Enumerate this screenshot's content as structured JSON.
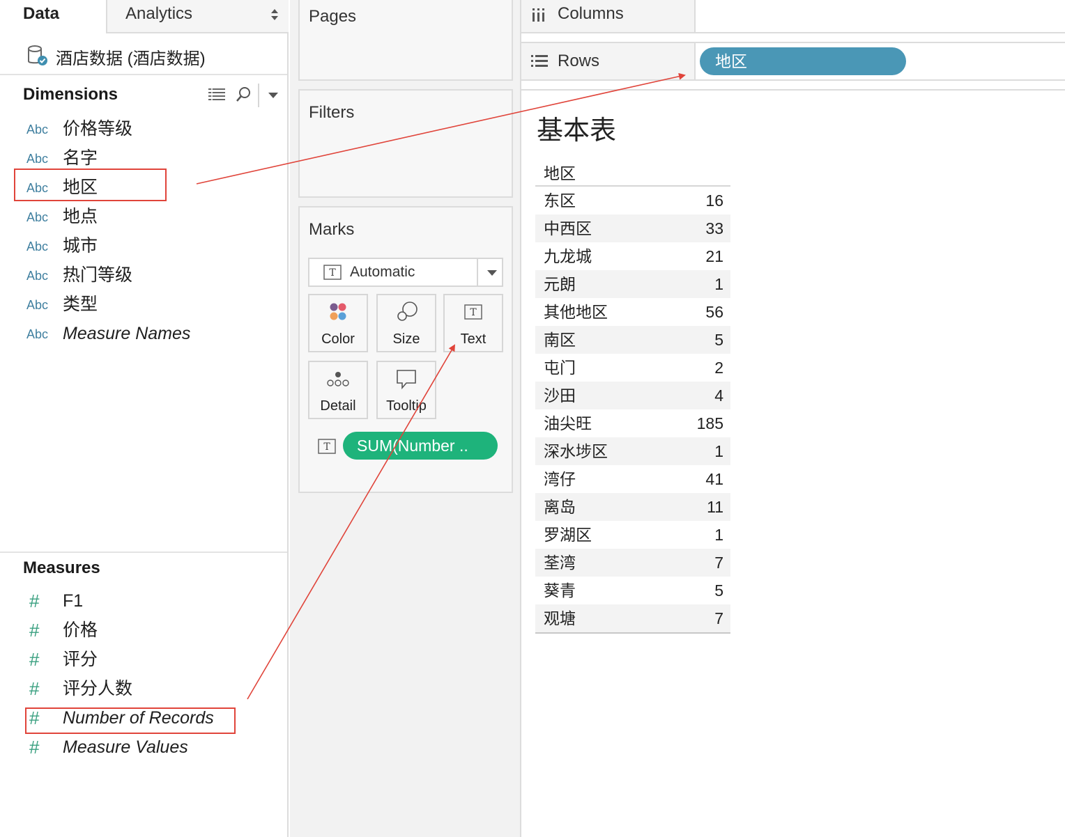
{
  "tabs": {
    "data": "Data",
    "analytics": "Analytics"
  },
  "datasource": {
    "name": "酒店数据 (酒店数据)"
  },
  "dimensions": {
    "title": "Dimensions",
    "type_label": "Abc",
    "items": [
      {
        "label": "价格等级",
        "italic": false
      },
      {
        "label": "名字",
        "italic": false
      },
      {
        "label": "地区",
        "italic": false,
        "highlighted": true
      },
      {
        "label": "地点",
        "italic": false
      },
      {
        "label": "城市",
        "italic": false
      },
      {
        "label": "热门等级",
        "italic": false
      },
      {
        "label": "类型",
        "italic": false
      },
      {
        "label": "Measure Names",
        "italic": true
      }
    ]
  },
  "measures": {
    "title": "Measures",
    "items": [
      {
        "label": "F1",
        "italic": false
      },
      {
        "label": "价格",
        "italic": false
      },
      {
        "label": "评分",
        "italic": false
      },
      {
        "label": "评分人数",
        "italic": false
      },
      {
        "label": "Number of Records",
        "italic": true,
        "highlighted": true
      },
      {
        "label": "Measure Values",
        "italic": true
      }
    ]
  },
  "cards": {
    "pages": "Pages",
    "filters": "Filters",
    "marks": "Marks"
  },
  "marks": {
    "type": "Automatic",
    "buttons": {
      "color": "Color",
      "size": "Size",
      "text": "Text",
      "detail": "Detail",
      "tooltip": "Tooltip"
    },
    "text_pill": "SUM(Number .."
  },
  "shelves": {
    "columns": "Columns",
    "rows": "Rows",
    "rows_pill": "地区"
  },
  "view": {
    "title": "基本表",
    "header": "地区",
    "rows": [
      {
        "name": "东区",
        "value": "16"
      },
      {
        "name": "中西区",
        "value": "33"
      },
      {
        "name": "九龙城",
        "value": "21"
      },
      {
        "name": "元朗",
        "value": "1"
      },
      {
        "name": "其他地区",
        "value": "56"
      },
      {
        "name": "南区",
        "value": "5"
      },
      {
        "name": "屯门",
        "value": "2"
      },
      {
        "name": "沙田",
        "value": "4"
      },
      {
        "name": "油尖旺",
        "value": "185"
      },
      {
        "name": "深水埗区",
        "value": "1"
      },
      {
        "name": "湾仔",
        "value": "41"
      },
      {
        "name": "离岛",
        "value": "11"
      },
      {
        "name": "罗湖区",
        "value": "1"
      },
      {
        "name": "荃湾",
        "value": "7"
      },
      {
        "name": "葵青",
        "value": "5"
      },
      {
        "name": "观塘",
        "value": "7"
      }
    ]
  },
  "colors": {
    "rows_pill": "#4a97b6",
    "measure_pill": "#1eb37b",
    "annotation": "#e0443a",
    "dimension_icon": "#3f7f9f",
    "measure_icon": "#3aa080"
  }
}
